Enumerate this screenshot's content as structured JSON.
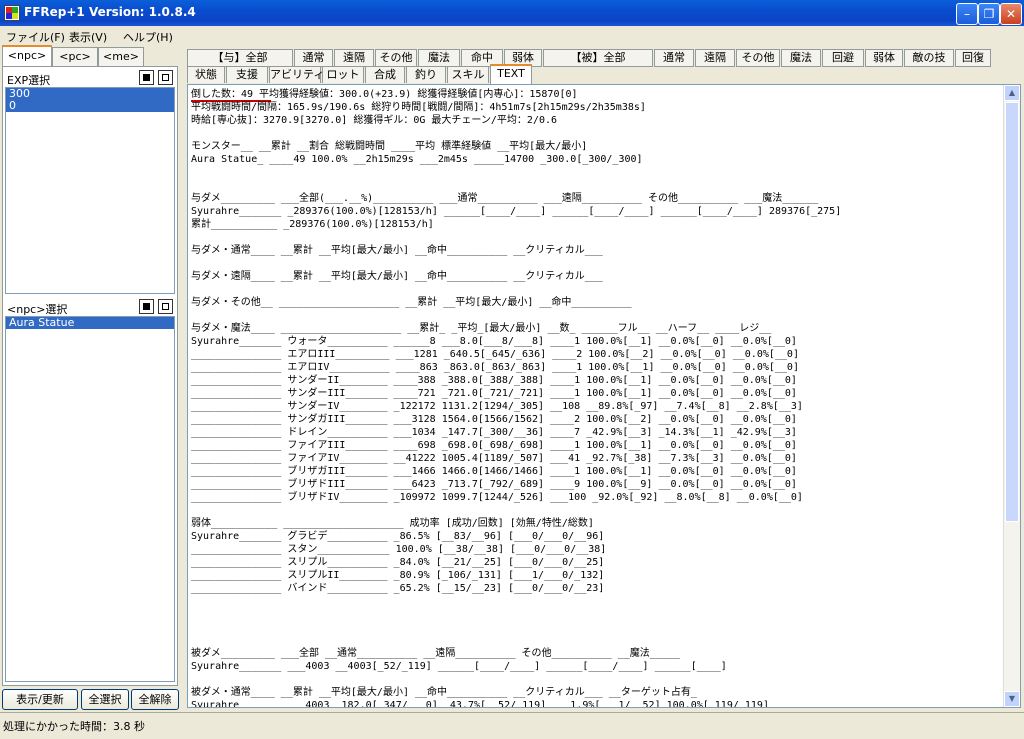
{
  "window": {
    "title": "FFRep+1 Version: 1.0.8.4"
  },
  "menu": [
    "ファイル(F)",
    "表示(V)",
    "ヘルプ(H)"
  ],
  "left_tabs": [
    "<npc>",
    "<pc>",
    "<me>"
  ],
  "exp_panel": {
    "label": "EXP選択",
    "items": [
      "300",
      "0"
    ]
  },
  "npc_panel": {
    "label": "<npc>選択",
    "items": [
      "Aura Statue"
    ]
  },
  "bottom_buttons": [
    "表示/更新",
    "全選択",
    "全解除"
  ],
  "top_buttons": [
    "【与】全部",
    "通常",
    "遠隔",
    "その他",
    "魔法",
    "命中",
    "弱体",
    "【被】全部",
    "通常",
    "遠隔",
    "その他",
    "魔法",
    "回避",
    "弱体",
    "敵の技",
    "回復"
  ],
  "tabs": [
    "状態",
    "支援",
    "アビリティ",
    "ロット",
    "合成",
    "釣り",
    "スキル",
    "TEXT"
  ],
  "report_lines": [
    "倒した数：49 平均獲得経験値：300.0(+23.9) 総獲得経験値[内専心]：15870[0]",
    "平均戦闘時間/間隔：165.9s/190.6s 総狩り時間[戦闘/間隔]：4h51m7s[2h15m29s/2h35m38s]",
    "時給[専心抜]：3270.9[3270.0] 総獲得ギル：0G 最大チェーン/平均：2/0.6",
    "",
    "モンスター__ __累計 __割合 総戦闘時間 ____平均 標準経験値 __平均[最大/最小]",
    "Aura Statue_ ____49 100.0% __2h15m29s ___2m45s _____14700 _300.0[_300/_300]",
    "",
    "",
    "与ダメ_________ ___全部(___.__%)__________ ___通常__________ ___遠隔__________ その他__________ ___魔法______",
    "Syurahre_______ _289376(100.0%)[128153/h] ______[____/____] ______[____/____] ______[____/____] 289376[_275]",
    "累計___________ _289376(100.0%)[128153/h]",
    "",
    "与ダメ・通常____ __累計 __平均[最大/最小] __命中__________ __クリティカル___",
    "",
    "与ダメ・遠隔____ __累計 __平均[最大/最小] __命中__________ __クリティカル___",
    "",
    "与ダメ・その他__ ____________________ __累計 __平均[最大/最小] __命中__________",
    "",
    "与ダメ・魔法____ ____________________ __累計_ _平均_[最大/最小] __数_ ______フル__ __ハーフ__ ____レジ__",
    "Syurahre_______ ウォータ__________ ______8 ___8.0[___8/___8] ____1 100.0%[__1] __0.0%[__0] __0.0%[__0]",
    "_______________ エアロIII_________ ___1281 _640.5[_645/_636] ____2 100.0%[__2] __0.0%[__0] __0.0%[__0]",
    "_______________ エアロIV__________ ____863 _863.0[_863/_863] ____1 100.0%[__1] __0.0%[__0] __0.0%[__0]",
    "_______________ サンダーII________ ____388 _388.0[_388/_388] ____1 100.0%[__1] __0.0%[__0] __0.0%[__0]",
    "_______________ サンダーIII_______ ____721 _721.0[_721/_721] ____1 100.0%[__1] __0.0%[__0] __0.0%[__0]",
    "_______________ サンダーIV________ _122172 1131.2[1294/_305] __108 __89.8%[_97] __7.4%[__8] __2.8%[__3]",
    "_______________ サンダガIII_______ ___3128 1564.0[1566/1562] ____2 100.0%[__2] __0.0%[__0] __0.0%[__0]",
    "_______________ ドレイン__________ ___1034 _147.7[_300/__36] ____7 _42.9%[__3] _14.3%[__1] _42.9%[__3]",
    "_______________ ファイアIII_______ ____698 _698.0[_698/_698] ____1 100.0%[__1] __0.0%[__0] __0.0%[__0]",
    "_______________ ファイアIV________ __41222 1005.4[1189/_507] ___41 _92.7%[_38] __7.3%[__3] __0.0%[__0]",
    "_______________ ブリザガIII_______ ___1466 1466.0[1466/1466] ____1 100.0%[__1] __0.0%[__0] __0.0%[__0]",
    "_______________ ブリザドIII_______ ___6423 _713.7[_792/_689] ____9 100.0%[__9] __0.0%[__0] __0.0%[__0]",
    "_______________ ブリザドIV________ _109972 1099.7[1244/_526] ___100 _92.0%[_92] __8.0%[__8] __0.0%[__0]",
    "",
    "弱体___________ ____________________ 成功率 [成功/回数] [効無/特性/総数]",
    "Syurahre_______ グラビデ__________ _86.5% [__83/__96] [___0/___0/__96]",
    "_______________ スタン____________ 100.0% [__38/__38] [___0/___0/__38]",
    "_______________ スリプル__________ _84.0% [__21/__25] [___0/___0/__25]",
    "_______________ スリプルII________ _80.9% [_106/_131] [___1/___0/_132]",
    "_______________ バインド__________ _65.2% [__15/__23] [___0/___0/__23]",
    "",
    "",
    "",
    "",
    "被ダメ_________ ___全部 __通常__________ __遠隔__________ その他__________ __魔法_____",
    "Syurahre_______ ___4003 __4003[_52/_119] ______[____/____] ______[____/____] ______[____]",
    "",
    "被ダメ・通常____ __累計 __平均[最大/最小] __命中__________ __クリティカル___ __ターゲット占有_",
    "Syurahre_______ ___4003 _182.0[_347/___0] _43.7%[__52/_119] ___1.9%[___1/__52] 100.0%[_119/_119]"
  ],
  "status": "処理にかかった時間：3.8 秒"
}
